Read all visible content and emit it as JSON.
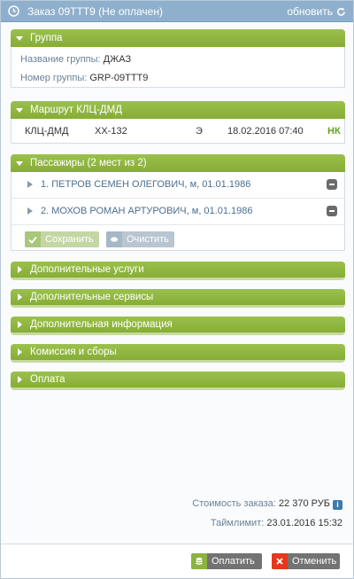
{
  "window": {
    "title": "Заказ 09ТТТ9 (Не оплачен)",
    "refresh_label": "обновить"
  },
  "group": {
    "header": "Группа",
    "name_label": "Название группы:",
    "name_value": "ДЖАЗ",
    "number_label": "Номер группы:",
    "number_value": "GRP-09TTT9"
  },
  "route": {
    "header": "Маршрут КЛЦ-ДМД",
    "segment": "КЛЦ-ДМД",
    "flight": "XX-132",
    "class": "Э",
    "datetime": "18.02.2016 07:40",
    "status": "НК"
  },
  "passengers": {
    "header": "Пассажиры (2 мест из 2)",
    "items": [
      {
        "label": "1. ПЕТРОВ СЕМЕН ОЛЕГОВИЧ, м, 01.01.1986"
      },
      {
        "label": "2. МОХОВ РОМАН АРТУРОВИЧ, м, 01.01.1986"
      }
    ],
    "save_label": "Сохранить",
    "clear_label": "Очистить"
  },
  "collapsed_sections": [
    {
      "label": "Дополнительные услуги"
    },
    {
      "label": "Дополнительные сервисы"
    },
    {
      "label": "Дополнительная информация"
    },
    {
      "label": "Комиссия и сборы"
    },
    {
      "label": "Оплата"
    }
  ],
  "summary": {
    "cost_label": "Стоимость заказа:",
    "cost_value": "22 370 РУБ",
    "timelimit_label": "Таймлимит:",
    "timelimit_value": "23.01.2016 15:32"
  },
  "actions": {
    "pay_label": "Оплатить",
    "cancel_label": "Отменить"
  },
  "colors": {
    "accent_green": "#8cb33e",
    "titlebar_blue": "#8fb0cd",
    "cancel_red": "#e5371f"
  }
}
